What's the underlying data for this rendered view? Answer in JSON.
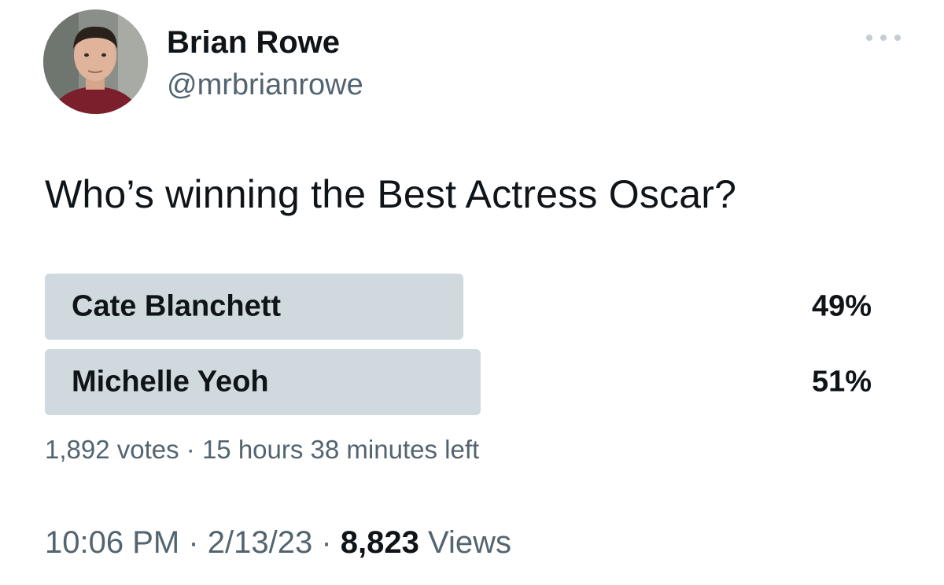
{
  "author": {
    "name": "Brian Rowe",
    "handle": "@mrbrianrowe",
    "avatar_icon": "user-avatar-photo"
  },
  "more_icon": "more-horizontal-icon",
  "tweet": {
    "text": "Who’s winning the Best Actress Oscar?"
  },
  "poll": {
    "options": [
      {
        "label": "Cate Blanchett",
        "percent_label": "49%",
        "percent": 49
      },
      {
        "label": "Michelle Yeoh",
        "percent_label": "51%",
        "percent": 51
      }
    ],
    "votes": "1,892 votes",
    "separator": " · ",
    "time_left": "15 hours 38 minutes left"
  },
  "meta": {
    "time": "10:06 PM",
    "date": "2/13/23",
    "separator": " · ",
    "views_count": "8,823",
    "views_label": "Views"
  },
  "colors": {
    "bar": "#cfd9de",
    "secondary_text": "#536471",
    "primary_text": "#0f1419"
  }
}
